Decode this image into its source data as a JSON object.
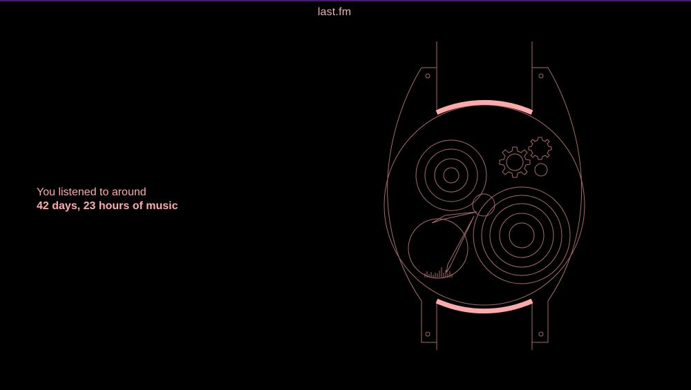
{
  "header": {
    "logo_text": "last.fm"
  },
  "stat": {
    "intro": "You listened to around",
    "value": "42 days, 23 hours of music"
  },
  "colors": {
    "background": "#000000",
    "accent": "#ffaaaa",
    "line": "#a86c6c",
    "top_rule": "#4b1a6e"
  },
  "illustration": {
    "icon": "watch-icon"
  }
}
